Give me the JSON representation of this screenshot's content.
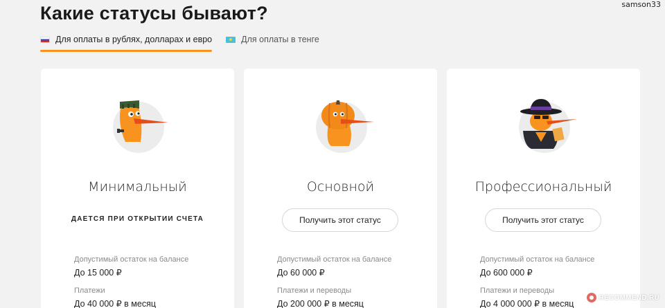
{
  "user": {
    "name": "samson33"
  },
  "page": {
    "title": "Какие статусы бывают?"
  },
  "tabs": [
    {
      "label": "Для оплаты в рублях, долларах и евро",
      "flag": "russia-flag-icon",
      "active": true
    },
    {
      "label": "Для оплаты в тенге",
      "flag": "kazakhstan-flag-icon",
      "active": false
    }
  ],
  "accent_color": "#f7931e",
  "cards": [
    {
      "name": "Минимальный",
      "mascot": "frankenstein-bird-icon",
      "note": "ДАЕТСЯ ПРИ ОТКРЫТИИ СЧЕТА",
      "balance_label": "Допустимый остаток на балансе",
      "balance_value": "До 15 000 ₽",
      "payments_label": "Платежи",
      "payments_value": "До 40 000 ₽ в месяц"
    },
    {
      "name": "Основной",
      "mascot": "pumpkin-bird-icon",
      "button": "Получить этот статус",
      "balance_label": "Допустимый остаток на балансе",
      "balance_value": "До 60 000 ₽",
      "payments_label": "Платежи и переводы",
      "payments_value": "До 200 000 ₽ в месяц"
    },
    {
      "name": "Профессиональный",
      "mascot": "spy-bird-icon",
      "button": "Получить этот статус",
      "balance_label": "Допустимый остаток на балансе",
      "balance_value": "До 600 000 ₽",
      "payments_label": "Платежи и переводы",
      "payments_value": "До 4 000 000 ₽ в месяц"
    }
  ],
  "watermark": {
    "text": "RECOMMEND.RU"
  }
}
